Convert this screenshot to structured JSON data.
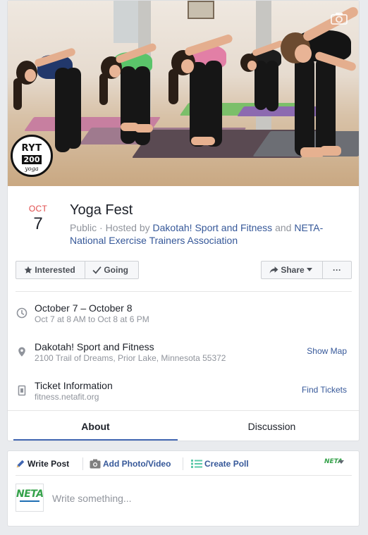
{
  "cover": {
    "badge": {
      "main": "RYT",
      "number": "200",
      "sub": "yoga",
      "icon": "ryt-200-badge"
    },
    "camera_icon": "camera-icon"
  },
  "event": {
    "month": "OCT",
    "day": "7",
    "title": "Yoga Fest",
    "privacy": "Public",
    "hosted_by": "Hosted by",
    "host1": "Dakotah! Sport and Fitness",
    "and": "and",
    "host2": "NETA-National Exercise Trainers Association"
  },
  "actions": {
    "interested": "Interested",
    "going": "Going",
    "share": "Share",
    "more": "···"
  },
  "info": {
    "time": {
      "main": "October 7 – October 8",
      "sub": "Oct 7 at 8 AM to Oct 8 at 6 PM",
      "icon": "clock-icon"
    },
    "place": {
      "main": "Dakotah! Sport and Fitness",
      "sub": "2100 Trail of Dreams, Prior Lake, Minnesota 55372",
      "link": "Show Map",
      "icon": "pin-icon"
    },
    "ticket": {
      "main": "Ticket Information",
      "sub": "fitness.netafit.org",
      "link": "Find Tickets",
      "icon": "ticket-icon"
    }
  },
  "tabs": [
    {
      "label": "About",
      "active": true
    },
    {
      "label": "Discussion",
      "active": false
    }
  ],
  "composer": {
    "write_post": "Write Post",
    "add_photo": "Add Photo/Video",
    "create_poll": "Create Poll",
    "page_mark": "NETA",
    "avatar_text": "NETA",
    "placeholder": "Write something..."
  },
  "colors": {
    "link": "#365899",
    "accent": "#4267b2",
    "month_red": "#e04a4a",
    "neta_green": "#35a24a"
  }
}
